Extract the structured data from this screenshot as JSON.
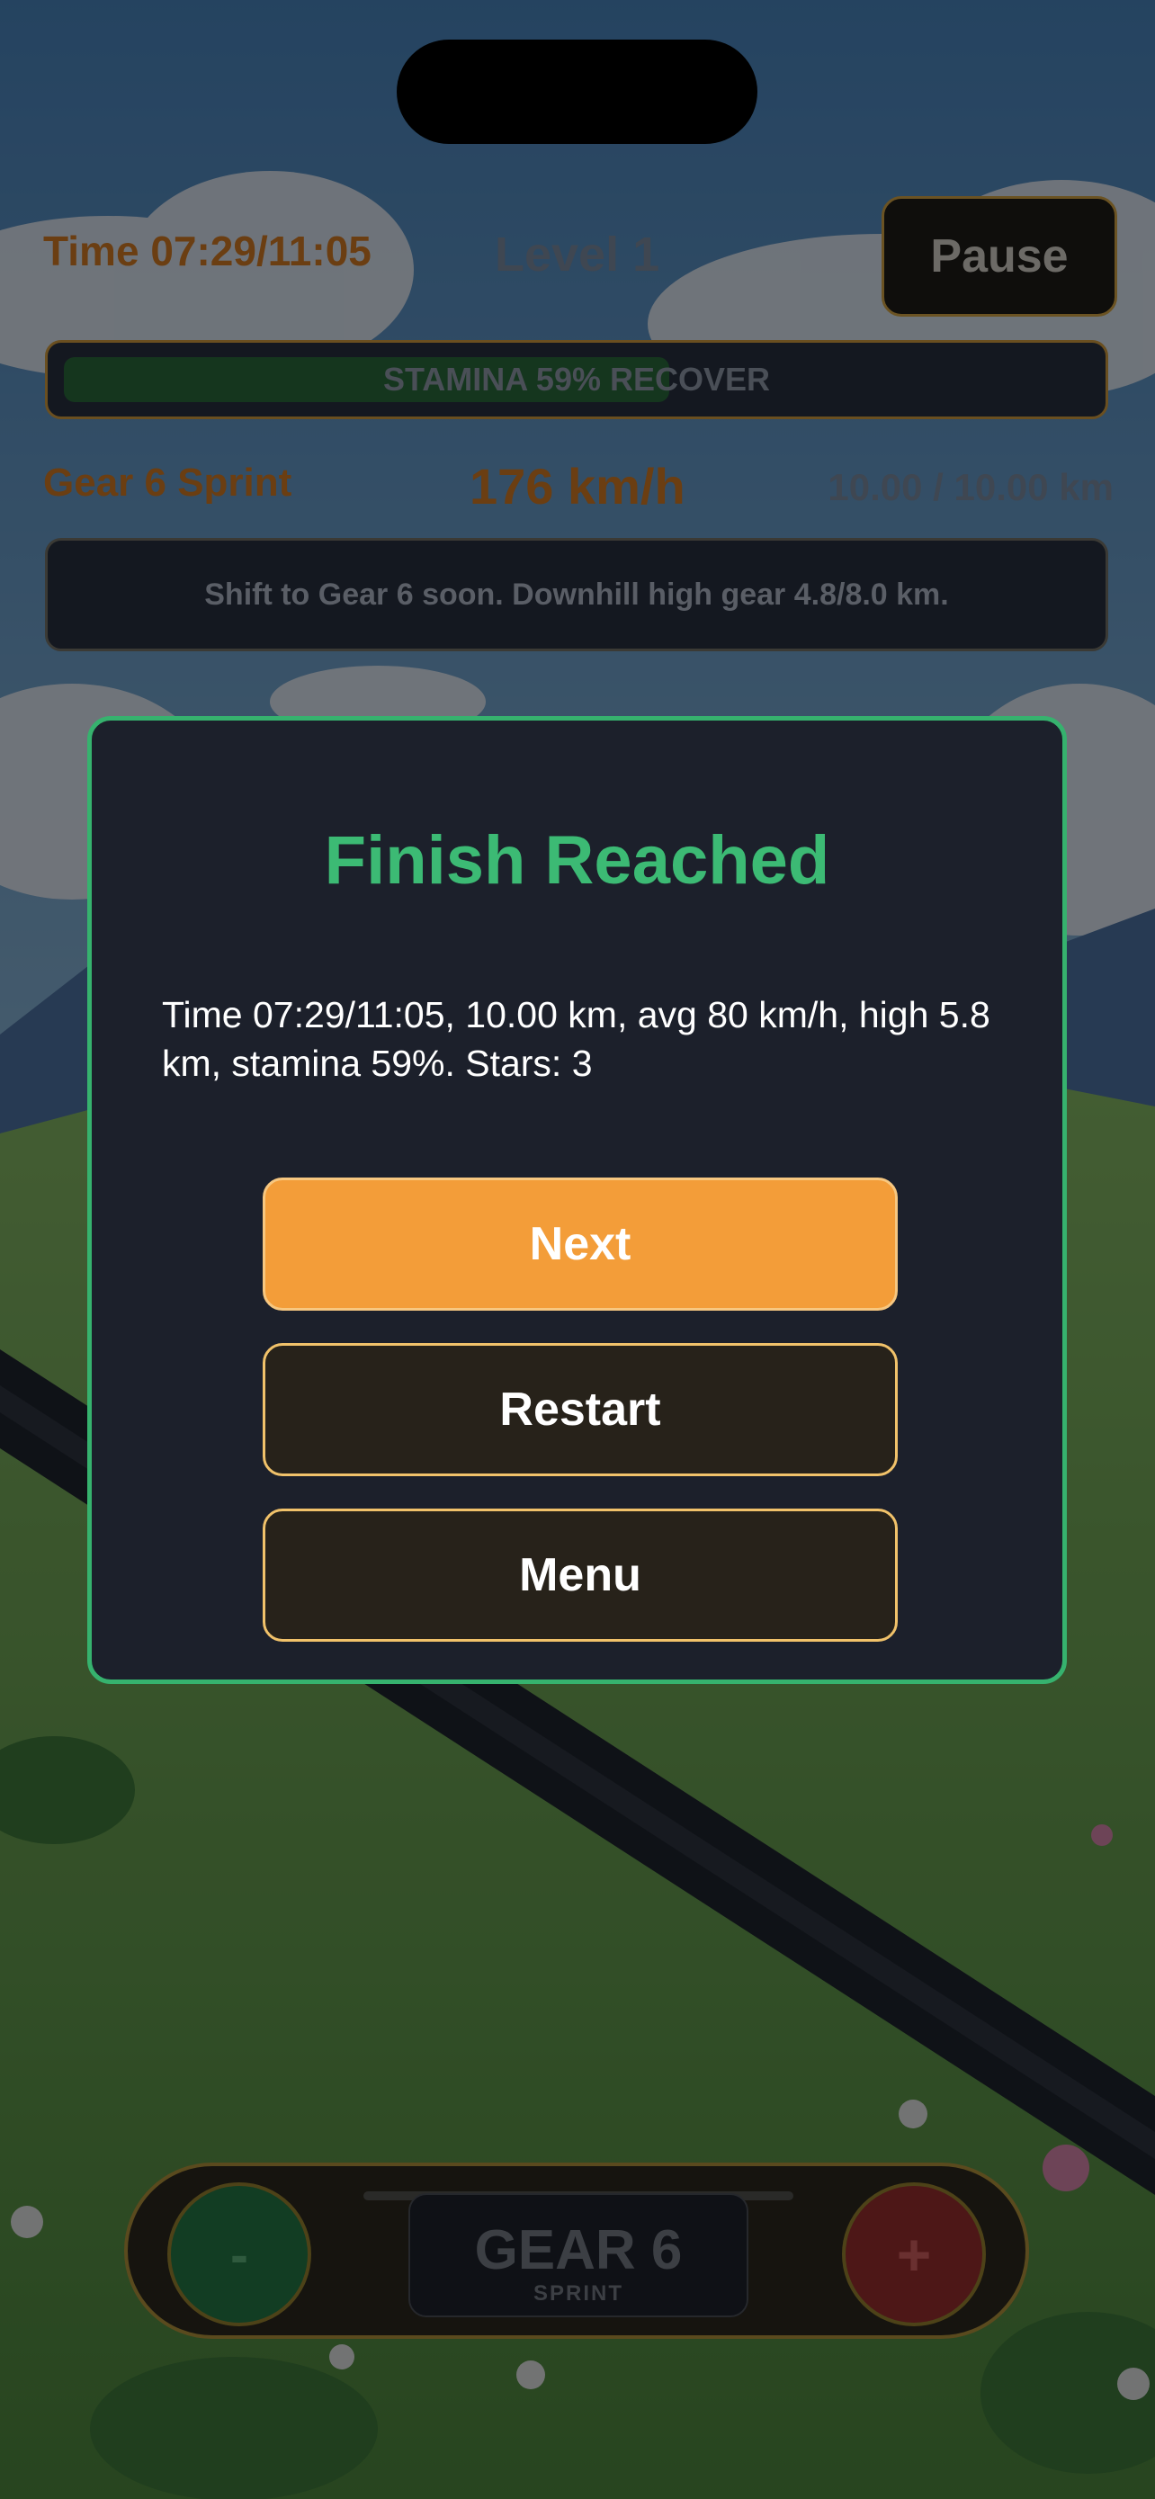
{
  "hud": {
    "time": "Time 07:29/11:05",
    "level": "Level 1",
    "pause_label": "Pause",
    "stamina_label": "STAMINA 59%  RECOVER",
    "stamina_fraction": 0.59,
    "gear_label": "Gear 6 Sprint",
    "speed": "176 km/h",
    "distance": "10.00 / 10.00 km",
    "hint": "Shift to Gear 6 soon. Downhill high gear 4.8/8.0 km."
  },
  "modal": {
    "title": "Finish Reached",
    "body": "Time 07:29/11:05, 10.00 km, avg 80 km/h, high 5.8 km, stamina 59%.  Stars: 3",
    "next_label": "Next",
    "restart_label": "Restart",
    "menu_label": "Menu"
  },
  "controls": {
    "minus_label": "-",
    "plus_label": "+",
    "gear_name": "GEAR 6",
    "gear_mode": "SPRINT"
  },
  "colors": {
    "accent_green": "#3cba74",
    "next_orange": "#f39d39",
    "button_border": "#f1c26a",
    "modal_bg": "#1c202b"
  }
}
